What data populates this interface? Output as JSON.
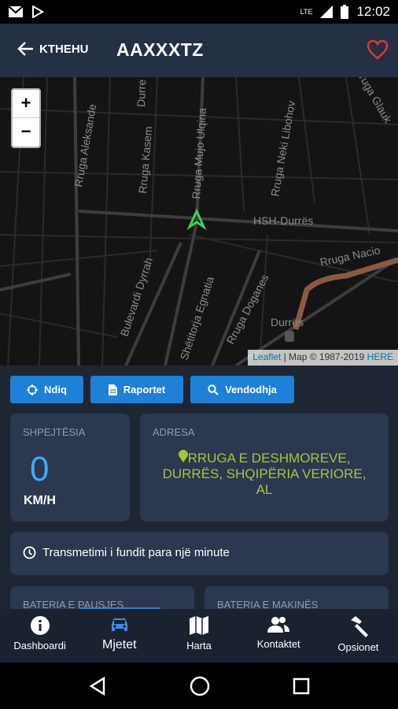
{
  "status_bar": {
    "time": "12:02",
    "network": "LTE"
  },
  "app_bar": {
    "back_label": "KTHEHU",
    "title": "AAXXXTZ"
  },
  "map": {
    "zoom_in": "+",
    "zoom_out": "−",
    "attribution_link": "Leaflet",
    "attribution_text": "| Map © 1987-2019",
    "attribution_here": "HERE",
    "labels": {
      "aleksande": "Rruga Aleksande",
      "kasem": "Rruga Kasem",
      "durre": "Durre",
      "mujo": "Rruga Mujo Ulqina",
      "neki": "Rruga Neki Libohov",
      "glauk": "ruga Glauk",
      "hsh": "HSH-Durrës",
      "nacio": "Rruga Nacio",
      "dyrrah": "Bulevardi Dyrrah",
      "egnatia": "Shëtitorja Egnatia",
      "doganes": "Rruga Doganes",
      "durres": "Durrës"
    }
  },
  "actions": {
    "follow": "Ndiq",
    "reports": "Raportet",
    "location": "Vendodhja"
  },
  "speed": {
    "label": "SHPEJTËSIA",
    "value": "0",
    "unit": "KM/H"
  },
  "address": {
    "label": "ADRESA",
    "text": "RRUGA E DESHMOREVE, DURRËS, SHQIPËRIA VERIORE, AL"
  },
  "last_transmission": "Transmetimi i fundit para një minute",
  "battery": {
    "pause_label": "BATERIA E PAUSJES",
    "car_label": "BATERIA E MAKINËS"
  },
  "bottom_nav": {
    "dashboard": "Dashboardi",
    "vehicles": "Mjetet",
    "map": "Harta",
    "contacts": "Kontaktet",
    "options": "Opsionet"
  },
  "colors": {
    "accent": "#1e80d6",
    "address": "#a7c637",
    "speed": "#3fa9f5",
    "favorite": "#e8323c"
  }
}
